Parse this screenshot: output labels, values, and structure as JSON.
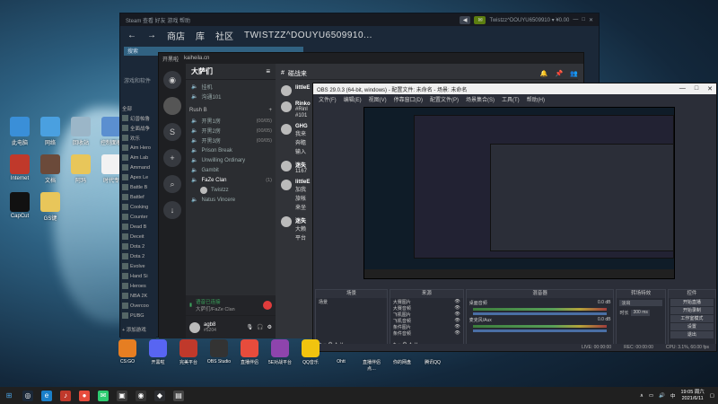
{
  "desktop": {
    "icons": [
      {
        "label": "此电脑"
      },
      {
        "label": "网络"
      },
      {
        "label": "回收站"
      },
      {
        "label": "控制面板"
      },
      {
        "label": "Internet"
      },
      {
        "label": "文档"
      },
      {
        "label": "阿玛"
      },
      {
        "label": "时代专"
      },
      {
        "label": "CapCut"
      },
      {
        "label": "GS键"
      }
    ],
    "dock_apps": [
      {
        "label": "CS:GO"
      },
      {
        "label": "开黑啦"
      },
      {
        "label": "完美平台"
      },
      {
        "label": "OBS Studio"
      },
      {
        "label": "直播伴侣"
      },
      {
        "label": "5E对战平台"
      },
      {
        "label": "QQ音乐"
      }
    ],
    "row_labels": [
      "Ohtt",
      "直播伴侣点…",
      "你的网盘",
      "腾讯QQ"
    ]
  },
  "steam": {
    "top_links": [
      "商店",
      "库",
      "社区"
    ],
    "title": "TWISTZZ^DOUYU6509910...",
    "search_placeholder": "搜索",
    "filter": "游戏和软件",
    "account": "Twistzz^DOUYU6509910 ▾ ¥0.00",
    "section": "全部",
    "games": [
      "幻兽帕鲁",
      "全面战争",
      "欢乐",
      "Aim Hero",
      "Aim Lab",
      "Ammand",
      "Apex Le",
      "Battle B",
      "Battlef",
      "Cooking",
      "Counter",
      "Dead B",
      "Deceit",
      "Dota 2",
      "Dota 2",
      "Evolve",
      "Hand Si",
      "Heroes",
      "NBA 2K",
      "Overcoo",
      "PUBG"
    ],
    "add_game": "+ 添加游戏"
  },
  "kaiheila": {
    "app_label": "开黑啦",
    "url": "kaiheila.cn",
    "server_name": "大萨们",
    "categories": [
      {
        "name": "Rush B"
      }
    ],
    "channels": [
      {
        "name": "挂机",
        "count": ""
      },
      {
        "name": "沟通101",
        "count": ""
      },
      {
        "name": "开黑1房",
        "count": "(00/05)"
      },
      {
        "name": "开黑2房",
        "count": "(00/05)"
      },
      {
        "name": "开黑3房",
        "count": "(00/05)"
      },
      {
        "name": "Prison Break",
        "count": ""
      },
      {
        "name": "Unwilling Ordinary",
        "count": ""
      },
      {
        "name": "Gambit",
        "count": ""
      },
      {
        "name": "FaZe Clan",
        "count": "(1)"
      },
      {
        "name": "Twistzz",
        "count": ""
      },
      {
        "name": "Natus Vincere",
        "count": ""
      }
    ],
    "voice_status": "语音已连接",
    "voice_sub": "大萨们/FaZe Clan",
    "user_name": "agb8",
    "user_tag": "#5204",
    "chat_header": "碰战来",
    "messages": [
      {
        "name": "littleE",
        "text": ""
      },
      {
        "name": "Rinko",
        "text": "#Rinl"
      },
      {
        "name": "",
        "text": "#101"
      },
      {
        "name": "GHG",
        "text": "我来"
      },
      {
        "name": "",
        "text": "奔瞻"
      },
      {
        "name": "",
        "text": "输入"
      },
      {
        "name": "迷失",
        "text": "1167"
      },
      {
        "name": "littleE",
        "text": "加我"
      },
      {
        "name": "",
        "text": "旅帐"
      },
      {
        "name": "",
        "text": "来坐"
      },
      {
        "name": "迷失",
        "text": "大赖"
      },
      {
        "name": "",
        "text": "平台"
      }
    ]
  },
  "obs": {
    "title": "OBS 29.0.3 (64-bit, windows) - 配置文件: 未命名 - 场景: 未命名",
    "menu": [
      "文件(F)",
      "编辑(E)",
      "视图(V)",
      "停靠窗口(D)",
      "配置文件(P)",
      "场景集合(S)",
      "工具(T)",
      "帮助(H)"
    ],
    "docks": {
      "scenes": {
        "title": "场景",
        "items": [
          "场景"
        ]
      },
      "sources": {
        "title": "来源",
        "items": [
          "大赛图片",
          "大赛音频",
          "飞机图片",
          "飞机音频",
          "条件图片",
          "条件音频"
        ]
      },
      "mixer": {
        "title": "混音器",
        "tracks": [
          {
            "name": "桌面音频",
            "db": "0.0 dB"
          },
          {
            "name": "麦克风/Aux",
            "db": "0.0 dB"
          }
        ]
      },
      "transitions": {
        "title": "转场特效",
        "type": "淡出",
        "duration_label": "时长",
        "duration": "300 ms"
      },
      "controls": {
        "title": "控件",
        "buttons": [
          "开始直播",
          "开始录制",
          "工作室模式",
          "设置",
          "退出"
        ]
      }
    },
    "status": [
      "LIVE: 00:00:00",
      "REC: 00:00:00",
      "CPU: 3.1%, 60.00 fps"
    ]
  },
  "taskbar": {
    "time": "19:05 周六",
    "date": "2021/6/11",
    "lang": "中"
  }
}
